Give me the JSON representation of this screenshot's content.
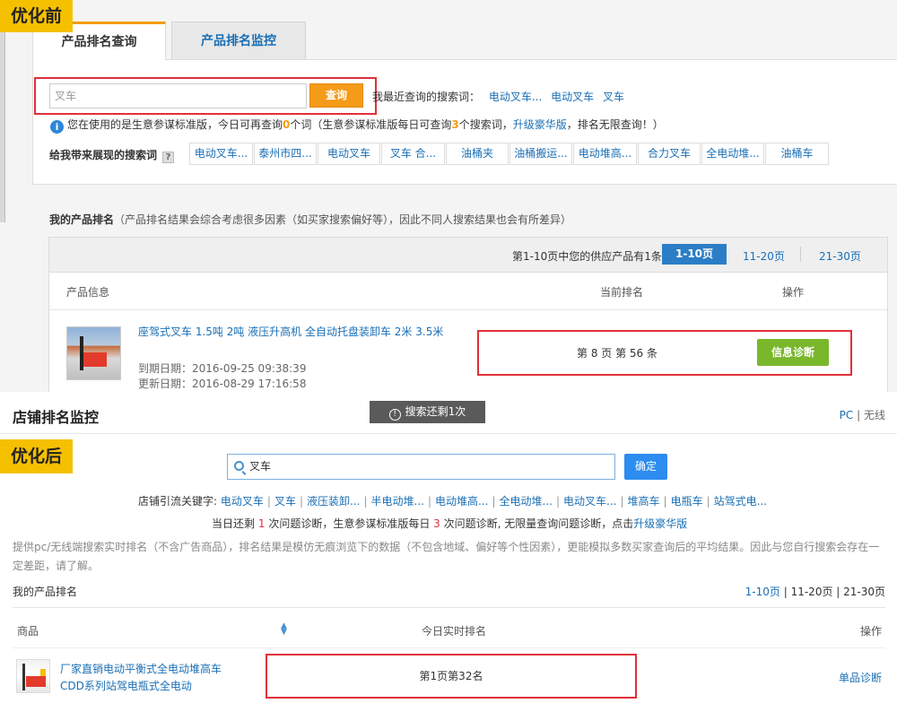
{
  "before": {
    "label": "优化前",
    "tabs": [
      {
        "label": "产品排名查询"
      },
      {
        "label": "产品排名监控"
      }
    ],
    "search": {
      "value": "叉车",
      "button": "查询"
    },
    "recent": {
      "label": "我最近查询的搜索词：",
      "terms": [
        "电动叉车...",
        "电动叉车",
        "叉车"
      ]
    },
    "info": {
      "part1": "您在使用的是生意参谋标准版，今日可再查询",
      "count_left": "0",
      "part2": "个词（生意参谋标准版每日可查询",
      "daily_limit": "3",
      "part3": "个搜索词，",
      "upgrade": "升级豪华版",
      "part4": "，排名无限查询！）"
    },
    "keywords": {
      "label": "给我带来展现的搜索词",
      "help": "?",
      "chips": [
        "电动叉车...",
        "泰州市四...",
        "电动叉车",
        "叉车 合...",
        "油桶夹",
        "油桶搬运...",
        "电动堆高...",
        "合力叉车",
        "全电动堆...",
        "油桶车"
      ]
    },
    "my_rank": {
      "title": "我的产品排名",
      "note": "（产品排名结果会综合考虑很多因素（如买家搜索偏好等），因此不同人搜索结果也会有所差异）",
      "summary": "第1-10页中您的供应产品有1条",
      "pages": [
        "1-10页",
        "11-20页",
        "21-30页"
      ],
      "columns": [
        "产品信息",
        "当前排名",
        "操作"
      ]
    },
    "product": {
      "title": "座驾式叉车 1.5吨 2吨 液压升高机 全自动托盘装卸车 2米 3.5米",
      "expire": "到期日期：2016-09-25 09:38:39",
      "update": "更新日期：2016-08-29 17:16:58",
      "rank": "第 8 页  第 56 条",
      "button": "信息诊断"
    }
  },
  "after": {
    "label": "优化后",
    "shop_title": "店铺排名监控",
    "remain": "搜索还剩1次",
    "remain_icon": "!",
    "platform": {
      "pc": "PC",
      "sep": "|",
      "mobile": "无线"
    },
    "search": {
      "value": "叉车",
      "button": "确定"
    },
    "keywords": {
      "label": "店铺引流关键字:",
      "terms": [
        "电动叉车",
        "叉车",
        "液压装卸...",
        "半电动堆...",
        "电动堆高...",
        "全电动堆...",
        "电动叉车...",
        "堆高车",
        "电瓶车",
        "站驾式电..."
      ]
    },
    "quota": {
      "part1": "当日还剩",
      "left": "1",
      "part2": "次问题诊断，生意参谋标准版每日",
      "daily": "3",
      "part3": "次问题诊断, 无限量查询问题诊断，点击",
      "upgrade": "升级豪华版"
    },
    "description": "提供pc/无线端搜索实时排名（不含广告商品），排名结果是模仿无痕浏览下的数据（不包含地域、偏好等个性因素），更能模拟多数买家查询后的平均结果。因此与您自行搜索会存在一定差距，请了解。",
    "my_rank": "我的产品排名",
    "pages": [
      "1-10页",
      "11-20页",
      "21-30页"
    ],
    "columns": [
      "商品",
      "今日实时排名",
      "操作"
    ],
    "sort_icon": "sort-icon",
    "product": {
      "title": "厂家直销电动平衡式全电动堆高车 CDD系列站驾电瓶式全电动",
      "rank": "第1页第32名",
      "action": "单品诊断"
    }
  },
  "colors": {
    "label_bg": "#f5c000",
    "highlight_box": "#e0303a",
    "link": "#1a6fb5",
    "orange_button": "#f59b1a",
    "green_button": "#79b72b",
    "blue_button": "#2d8cf0"
  }
}
